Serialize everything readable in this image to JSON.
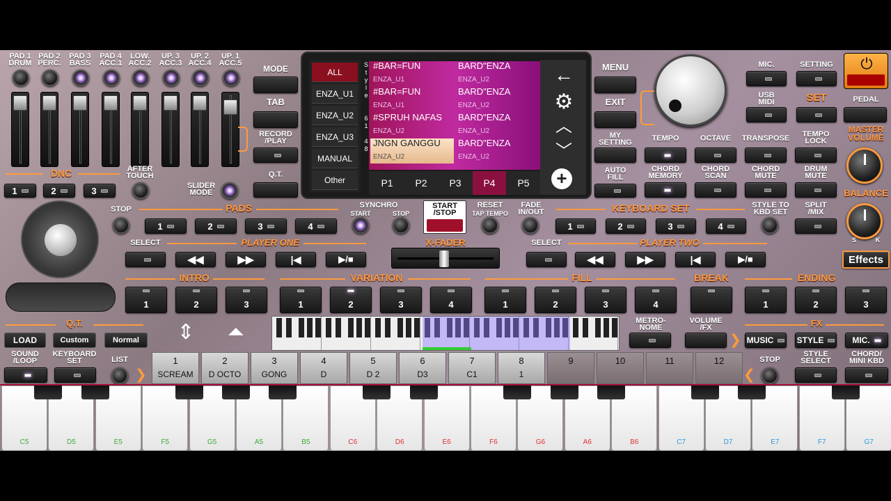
{
  "pads": {
    "labels": [
      "PAD 1\nDRUM",
      "PAD 2\nPERC.",
      "PAD 3\nBASS",
      "PAD 4\nACC.1",
      "LOW.\nACC.2",
      "UP. 3\nACC.3",
      "UP. 2\nACC.4",
      "UP. 1\nACC.5"
    ]
  },
  "dnc": {
    "label": "DNC",
    "b1": "1",
    "b2": "2",
    "b3": "3",
    "after_touch": "AFTER\nTOUCH",
    "slider_mode": "SLIDER\nMODE"
  },
  "mid_buttons": {
    "mode": "MODE",
    "tab": "TAB",
    "record": "RECORD\n/PLAY",
    "qt": "Q.T."
  },
  "screen": {
    "categories": [
      "ALL",
      "ENZA_U1",
      "ENZA_U2",
      "ENZA_U3",
      "MANUAL",
      "Other"
    ],
    "style_vert": "Style",
    "page_counter": "6 1 / 4 8",
    "cells": [
      {
        "name": "#BAR=FUN",
        "sub": "ENZA_U1"
      },
      {
        "name": "BARD\"ENZA",
        "sub": "ENZA_U2"
      },
      {
        "name": "#BAR=FUN",
        "sub": "ENZA_U1"
      },
      {
        "name": "BARD\"ENZA",
        "sub": "ENZA_U2"
      },
      {
        "name": "#SPRUH NAFAS",
        "sub": "ENZA_U2"
      },
      {
        "name": "BARD\"ENZA",
        "sub": "ENZA_U2"
      },
      {
        "name": "JNGN GANGGU",
        "sub": "ENZA_U2"
      },
      {
        "name": "BARD\"ENZA",
        "sub": "ENZA_U2"
      }
    ],
    "pages": [
      "P1",
      "P2",
      "P3",
      "P4",
      "P5"
    ]
  },
  "right_menu": {
    "menu": "MENU",
    "exit": "EXIT",
    "my_setting": "MY\nSETTING",
    "auto_fill": "AUTO\nFILL"
  },
  "top_right": {
    "mic": "MIC.",
    "setting": "SETTING",
    "usb_midi": "USB\nMIDI",
    "set": "SET",
    "pedal": "PEDAL",
    "tempo": "TEMPO",
    "octave": "OCTAVE",
    "transpose": "TRANSPOSE",
    "tempo_lock": "TEMPO\nLOCK",
    "master_volume": "MASTER\nVOLUME",
    "chord_memory": "CHORD\nMEMORY",
    "chord_scan": "CHORD\nSCAN",
    "chord_mute": "CHORD\nMUTE",
    "drum_mute": "DRUM\nMUTE",
    "balance": "BALANCE",
    "s": "S",
    "k": "K"
  },
  "pads_row": {
    "stop": "STOP",
    "pads": "PADS",
    "b1": "1",
    "b2": "2",
    "b3": "3",
    "b4": "4",
    "synchro": "SYNCHRO",
    "start": "START",
    "stop_small": "STOP",
    "start_stop": "START\n/STOP",
    "reset": "RESET",
    "tap_tempo": "TAP TEMPO",
    "fade": "FADE\nIN/OUT",
    "keyboard_set": "KEYBOARD SET",
    "k1": "1",
    "k2": "2",
    "k3": "3",
    "k4": "4",
    "style_to_kbd": "STYLE TO\nKBD SET",
    "split_mix": "SPLIT\n/MIX"
  },
  "player": {
    "select": "SELECT",
    "player_one": "PLAYER ONE",
    "xfader": "X-FADER",
    "select2": "SELECT",
    "player_two": "PLAYER TWO",
    "effects": "Effects"
  },
  "sections": {
    "intro": "INTRO",
    "variation": "VARIATION",
    "fill": "FILL",
    "break": "BREAK",
    "ending": "ENDING",
    "i": [
      "1",
      "2",
      "3"
    ],
    "v": [
      "1",
      "2",
      "3",
      "4"
    ],
    "f": [
      "1",
      "2",
      "3",
      "4"
    ],
    "e": [
      "1",
      "2",
      "3"
    ]
  },
  "bottom": {
    "qt": "Q.T.",
    "load": "LOAD",
    "custom": "Custom",
    "normal": "Normal",
    "metronome": "METRO-\nNOME",
    "volume_fx": "VOLUME\n/FX",
    "fx": "FX",
    "music": "MUSIC",
    "style": "STYLE",
    "mic": "MIC.",
    "sound_loop": "SOUND\n/LOOP",
    "keyboard_set": "KEYBOARD\nSET",
    "list": "LIST",
    "stop": "STOP",
    "style_select": "STYLE\nSELECT",
    "chord_mini": "CHORD/\nMINI KBD"
  },
  "slots": [
    {
      "n": "1",
      "t": "SCREAM"
    },
    {
      "n": "2",
      "t": "D OCTO"
    },
    {
      "n": "3",
      "t": "GONG"
    },
    {
      "n": "4",
      "t": "D"
    },
    {
      "n": "5",
      "t": "D 2"
    },
    {
      "n": "6",
      "t": "D3"
    },
    {
      "n": "7",
      "t": "C1"
    },
    {
      "n": "8",
      "t": "1"
    },
    {
      "n": "9",
      "t": ""
    },
    {
      "n": "10",
      "t": ""
    },
    {
      "n": "11",
      "t": ""
    },
    {
      "n": "12",
      "t": ""
    }
  ],
  "keys": [
    "C5",
    "D5",
    "E5",
    "F5",
    "G5",
    "A5",
    "B5",
    "C6",
    "D6",
    "E6",
    "F6",
    "G6",
    "A6",
    "B6",
    "C7",
    "D7",
    "E7",
    "F7",
    "G7"
  ],
  "key_colors": [
    "#3aaa3a",
    "#3aaa3a",
    "#3aaa3a",
    "#3aaa3a",
    "#3aaa3a",
    "#3aaa3a",
    "#3aaa3a",
    "#e03030",
    "#e03030",
    "#e03030",
    "#e03030",
    "#e03030",
    "#e03030",
    "#e03030",
    "#2a9ad8",
    "#2a9ad8",
    "#2a9ad8",
    "#2a9ad8",
    "#2a9ad8"
  ]
}
